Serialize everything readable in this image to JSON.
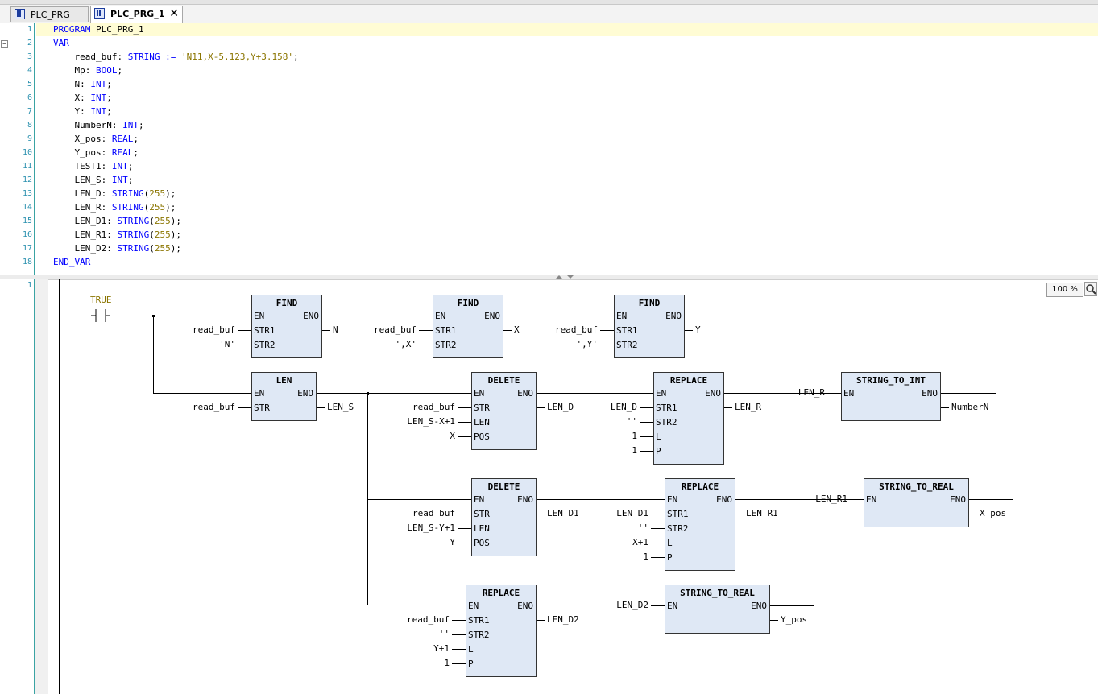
{
  "tabs": [
    {
      "label": "PLC_PRG",
      "active": false
    },
    {
      "label": "PLC_PRG_1",
      "active": true
    }
  ],
  "declaration": {
    "lines": [
      {
        "no": "1",
        "parts": [
          {
            "t": "PROGRAM",
            "c": "kw"
          },
          {
            "t": " PLC_PRG_1",
            "c": ""
          }
        ]
      },
      {
        "no": "2",
        "parts": [
          {
            "t": "VAR",
            "c": "kw"
          }
        ]
      },
      {
        "no": "3",
        "parts": [
          {
            "t": "    read_buf: ",
            "c": ""
          },
          {
            "t": "STRING",
            "c": "kw"
          },
          {
            "t": " := ",
            "c": "kw"
          },
          {
            "t": "'N11,X-5.123,Y+3.158'",
            "c": "str"
          },
          {
            "t": ";",
            "c": ""
          }
        ]
      },
      {
        "no": "4",
        "parts": [
          {
            "t": "    Mp: ",
            "c": ""
          },
          {
            "t": "BOOL",
            "c": "kw"
          },
          {
            "t": ";",
            "c": ""
          }
        ]
      },
      {
        "no": "5",
        "parts": [
          {
            "t": "    N: ",
            "c": ""
          },
          {
            "t": "INT",
            "c": "kw"
          },
          {
            "t": ";",
            "c": ""
          }
        ]
      },
      {
        "no": "6",
        "parts": [
          {
            "t": "    X: ",
            "c": ""
          },
          {
            "t": "INT",
            "c": "kw"
          },
          {
            "t": ";",
            "c": ""
          }
        ]
      },
      {
        "no": "7",
        "parts": [
          {
            "t": "    Y: ",
            "c": ""
          },
          {
            "t": "INT",
            "c": "kw"
          },
          {
            "t": ";",
            "c": ""
          }
        ]
      },
      {
        "no": "8",
        "parts": [
          {
            "t": "    NumberN: ",
            "c": ""
          },
          {
            "t": "INT",
            "c": "kw"
          },
          {
            "t": ";",
            "c": ""
          }
        ]
      },
      {
        "no": "9",
        "parts": [
          {
            "t": "    X_pos: ",
            "c": ""
          },
          {
            "t": "REAL",
            "c": "kw"
          },
          {
            "t": ";",
            "c": ""
          }
        ]
      },
      {
        "no": "10",
        "parts": [
          {
            "t": "    Y_pos: ",
            "c": ""
          },
          {
            "t": "REAL",
            "c": "kw"
          },
          {
            "t": ";",
            "c": ""
          }
        ]
      },
      {
        "no": "11",
        "parts": [
          {
            "t": "    TEST1: ",
            "c": ""
          },
          {
            "t": "INT",
            "c": "kw"
          },
          {
            "t": ";",
            "c": ""
          }
        ]
      },
      {
        "no": "12",
        "parts": [
          {
            "t": "    LEN_S: ",
            "c": ""
          },
          {
            "t": "INT",
            "c": "kw"
          },
          {
            "t": ";",
            "c": ""
          }
        ]
      },
      {
        "no": "13",
        "parts": [
          {
            "t": "    LEN_D: ",
            "c": ""
          },
          {
            "t": "STRING",
            "c": "kw"
          },
          {
            "t": "(",
            "c": ""
          },
          {
            "t": "255",
            "c": "num"
          },
          {
            "t": ");",
            "c": ""
          }
        ]
      },
      {
        "no": "14",
        "parts": [
          {
            "t": "    LEN_R: ",
            "c": ""
          },
          {
            "t": "STRING",
            "c": "kw"
          },
          {
            "t": "(",
            "c": ""
          },
          {
            "t": "255",
            "c": "num"
          },
          {
            "t": ");",
            "c": ""
          }
        ]
      },
      {
        "no": "15",
        "parts": [
          {
            "t": "    LEN_D1: ",
            "c": ""
          },
          {
            "t": "STRING",
            "c": "kw"
          },
          {
            "t": "(",
            "c": ""
          },
          {
            "t": "255",
            "c": "num"
          },
          {
            "t": ");",
            "c": ""
          }
        ]
      },
      {
        "no": "16",
        "parts": [
          {
            "t": "    LEN_R1: ",
            "c": ""
          },
          {
            "t": "STRING",
            "c": "kw"
          },
          {
            "t": "(",
            "c": ""
          },
          {
            "t": "255",
            "c": "num"
          },
          {
            "t": ");",
            "c": ""
          }
        ]
      },
      {
        "no": "17",
        "parts": [
          {
            "t": "    LEN_D2: ",
            "c": ""
          },
          {
            "t": "STRING",
            "c": "kw"
          },
          {
            "t": "(",
            "c": ""
          },
          {
            "t": "255",
            "c": "num"
          },
          {
            "t": ");",
            "c": ""
          }
        ]
      },
      {
        "no": "18",
        "parts": [
          {
            "t": "END_VAR",
            "c": "kw"
          }
        ]
      }
    ]
  },
  "zoom": "100 %",
  "network": {
    "number": "1",
    "contact_label": "TRUE",
    "blocks": [
      {
        "id": "find1",
        "title": "FIND",
        "en": "EN",
        "eno": "ENO",
        "inputs": [
          {
            "pin": "STR1",
            "arg": "read_buf"
          },
          {
            "pin": "STR2",
            "arg": "'N'"
          }
        ],
        "outputs": [
          "N"
        ]
      },
      {
        "id": "find2",
        "title": "FIND",
        "en": "EN",
        "eno": "ENO",
        "inputs": [
          {
            "pin": "STR1",
            "arg": "read_buf"
          },
          {
            "pin": "STR2",
            "arg": "',X'"
          }
        ],
        "outputs": [
          "X"
        ]
      },
      {
        "id": "find3",
        "title": "FIND",
        "en": "EN",
        "eno": "ENO",
        "inputs": [
          {
            "pin": "STR1",
            "arg": "read_buf"
          },
          {
            "pin": "STR2",
            "arg": "',Y'"
          }
        ],
        "outputs": [
          "Y"
        ]
      },
      {
        "id": "len",
        "title": "LEN",
        "en": "EN",
        "eno": "ENO",
        "inputs": [
          {
            "pin": "STR",
            "arg": "read_buf"
          }
        ],
        "outputs": [
          "LEN_S"
        ]
      },
      {
        "id": "del1",
        "title": "DELETE",
        "en": "EN",
        "eno": "ENO",
        "inputs": [
          {
            "pin": "STR",
            "arg": "read_buf"
          },
          {
            "pin": "LEN",
            "arg": "LEN_S-X+1"
          },
          {
            "pin": "POS",
            "arg": "X"
          }
        ],
        "outputs": [
          "LEN_D"
        ]
      },
      {
        "id": "rep1",
        "title": "REPLACE",
        "en": "EN",
        "eno": "ENO",
        "inputs": [
          {
            "pin": "STR1",
            "arg": "LEN_D"
          },
          {
            "pin": "STR2",
            "arg": "''"
          },
          {
            "pin": "L",
            "arg": "1"
          },
          {
            "pin": "P",
            "arg": "1"
          }
        ],
        "outputs": [
          "LEN_R"
        ]
      },
      {
        "id": "s2i",
        "title": "STRING_TO_INT",
        "en": "EN",
        "eno": "ENO",
        "inputs": [
          {
            "pin": "",
            "arg": "LEN_R"
          }
        ],
        "outputs": [
          "NumberN"
        ]
      },
      {
        "id": "del2",
        "title": "DELETE",
        "en": "EN",
        "eno": "ENO",
        "inputs": [
          {
            "pin": "STR",
            "arg": "read_buf"
          },
          {
            "pin": "LEN",
            "arg": "LEN_S-Y+1"
          },
          {
            "pin": "POS",
            "arg": "Y"
          }
        ],
        "outputs": [
          "LEN_D1"
        ]
      },
      {
        "id": "rep2",
        "title": "REPLACE",
        "en": "EN",
        "eno": "ENO",
        "inputs": [
          {
            "pin": "STR1",
            "arg": "LEN_D1"
          },
          {
            "pin": "STR2",
            "arg": "''"
          },
          {
            "pin": "L",
            "arg": "X+1"
          },
          {
            "pin": "P",
            "arg": "1"
          }
        ],
        "outputs": [
          "LEN_R1"
        ]
      },
      {
        "id": "s2r1",
        "title": "STRING_TO_REAL",
        "en": "EN",
        "eno": "ENO",
        "inputs": [
          {
            "pin": "",
            "arg": "LEN_R1"
          }
        ],
        "outputs": [
          "X_pos"
        ]
      },
      {
        "id": "rep3",
        "title": "REPLACE",
        "en": "EN",
        "eno": "ENO",
        "inputs": [
          {
            "pin": "STR1",
            "arg": "read_buf"
          },
          {
            "pin": "STR2",
            "arg": "''"
          },
          {
            "pin": "L",
            "arg": "Y+1"
          },
          {
            "pin": "P",
            "arg": "1"
          }
        ],
        "outputs": [
          "LEN_D2"
        ]
      },
      {
        "id": "s2r2",
        "title": "STRING_TO_REAL",
        "en": "EN",
        "eno": "ENO",
        "inputs": [
          {
            "pin": "",
            "arg": "LEN_D2"
          }
        ],
        "outputs": [
          "Y_pos"
        ]
      }
    ]
  },
  "colors": {
    "keyword": "#0000ff",
    "literal": "#8b7500",
    "line_number": "#2b91af",
    "block_fill": "#dfe8f5"
  }
}
